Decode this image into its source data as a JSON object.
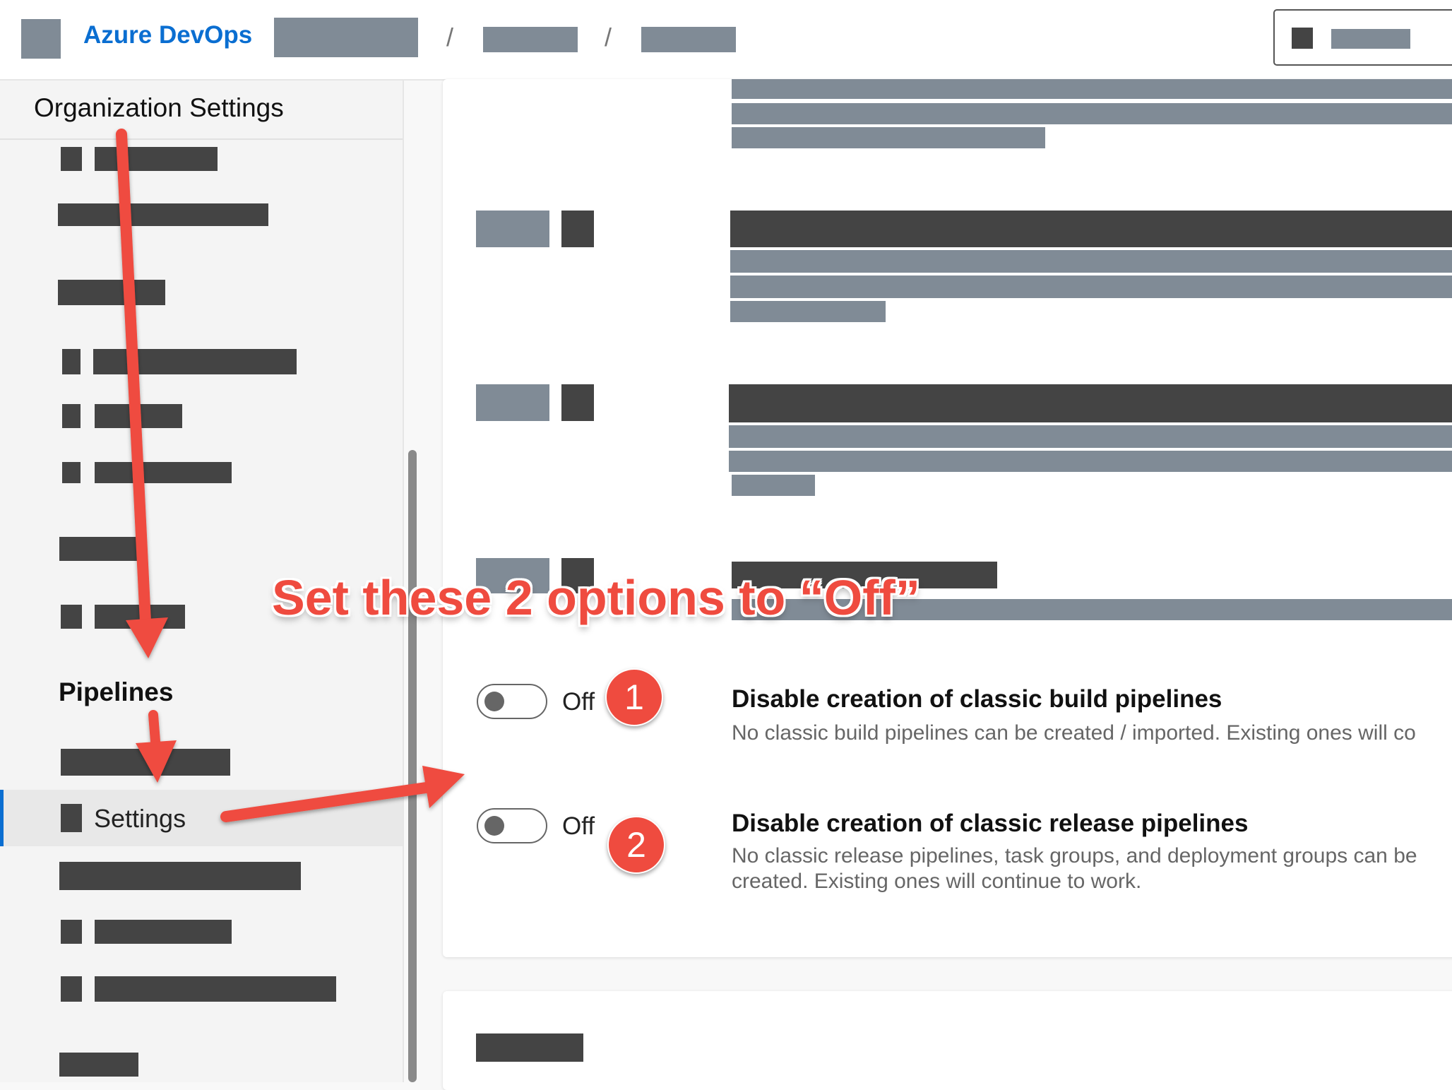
{
  "header": {
    "brand": "Azure DevOps",
    "breadcrumb_separators": [
      "/",
      "/"
    ]
  },
  "sidebar": {
    "title": "Organization Settings",
    "pipelines_heading": "Pipelines",
    "selected_item_label": "Settings"
  },
  "options": [
    {
      "state": "Off",
      "title": "Disable creation of classic build pipelines",
      "description": "No classic build pipelines can be created / imported. Existing ones will co"
    },
    {
      "state": "Off",
      "title": "Disable creation of classic release pipelines",
      "description": "No classic release pipelines, task groups, and deployment groups can be created. Existing ones will continue to work."
    }
  ],
  "annotation": {
    "text": "Set these 2 options to “Off”",
    "badges": [
      "1",
      "2"
    ]
  },
  "colors": {
    "accent": "#0a6ed1",
    "annotation": "#ef4b3f"
  }
}
